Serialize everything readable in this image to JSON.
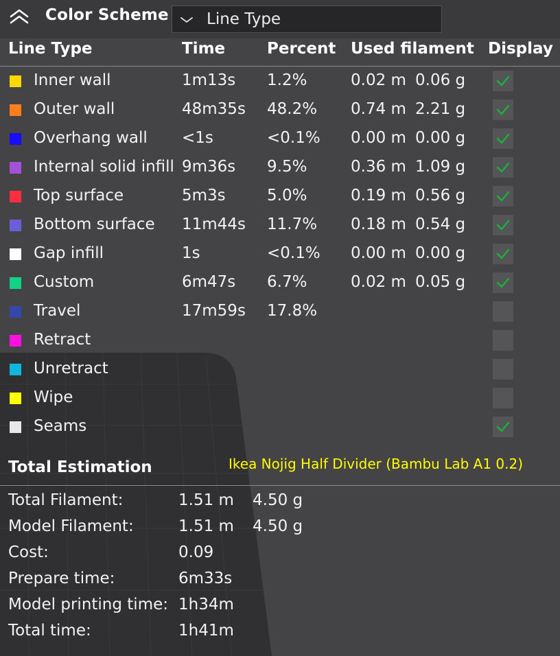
{
  "header": {
    "title": "Color Scheme",
    "dropdown_value": "Line Type"
  },
  "columns": {
    "line_type": "Line Type",
    "time": "Time",
    "percent": "Percent",
    "used_filament": "Used filament",
    "display": "Display"
  },
  "rows": [
    {
      "name": "Inner wall",
      "color": "#ffd700",
      "time": "1m13s",
      "percent": "1.2%",
      "length": "0.02 m",
      "weight": "0.06 g",
      "display": true
    },
    {
      "name": "Outer wall",
      "color": "#ff7f1e",
      "time": "48m35s",
      "percent": "48.2%",
      "length": "0.74 m",
      "weight": "2.21 g",
      "display": true
    },
    {
      "name": "Overhang wall",
      "color": "#1a0dff",
      "time": "<1s",
      "percent": "<0.1%",
      "length": "0.00 m",
      "weight": "0.00 g",
      "display": true
    },
    {
      "name": "Internal solid infill",
      "color": "#a352d8",
      "time": "9m36s",
      "percent": "9.5%",
      "length": "0.36 m",
      "weight": "1.09 g",
      "display": true
    },
    {
      "name": "Top surface",
      "color": "#ff2d40",
      "time": "5m3s",
      "percent": "5.0%",
      "length": "0.19 m",
      "weight": "0.56 g",
      "display": true
    },
    {
      "name": "Bottom surface",
      "color": "#6c5ed8",
      "time": "11m44s",
      "percent": "11.7%",
      "length": "0.18 m",
      "weight": "0.54 g",
      "display": true
    },
    {
      "name": "Gap infill",
      "color": "#ffffff",
      "time": "1s",
      "percent": "<0.1%",
      "length": "0.00 m",
      "weight": "0.00 g",
      "display": true
    },
    {
      "name": "Custom",
      "color": "#10d483",
      "time": "6m47s",
      "percent": "6.7%",
      "length": "0.02 m",
      "weight": "0.05 g",
      "display": true
    },
    {
      "name": "Travel",
      "color": "#3548aa",
      "time": "17m59s",
      "percent": "17.8%",
      "length": "",
      "weight": "",
      "display": false
    },
    {
      "name": "Retract",
      "color": "#ff10e0",
      "time": "",
      "percent": "",
      "length": "",
      "weight": "",
      "display": false
    },
    {
      "name": "Unretract",
      "color": "#0fb6e0",
      "time": "",
      "percent": "",
      "length": "",
      "weight": "",
      "display": false
    },
    {
      "name": "Wipe",
      "color": "#ffff00",
      "time": "",
      "percent": "",
      "length": "",
      "weight": "",
      "display": false
    },
    {
      "name": "Seams",
      "color": "#e8e8e8",
      "time": "",
      "percent": "",
      "length": "",
      "weight": "",
      "display": true
    }
  ],
  "model_label": "Ikea Nojig Half Divider (Bambu Lab A1 0.2)",
  "total": {
    "title": "Total Estimation",
    "rows": [
      {
        "label": "Total Filament:",
        "value": "1.51 m",
        "weight": "4.50 g"
      },
      {
        "label": "Model Filament:",
        "value": "1.51 m",
        "weight": "4.50 g"
      },
      {
        "label": "Cost:",
        "value": "0.09",
        "weight": ""
      },
      {
        "label": "Prepare time:",
        "value": "6m33s",
        "weight": ""
      },
      {
        "label": "Model printing time:",
        "value": "1h34m",
        "weight": ""
      },
      {
        "label": "Total time:",
        "value": "1h41m",
        "weight": ""
      }
    ]
  },
  "colors": {
    "check": "#19b23a",
    "panel_bg": "#444446",
    "plate": "#303032"
  },
  "icons": {
    "collapse": "chevron-double-up-icon",
    "dropdown": "chevron-down-icon",
    "checkbox": "check-icon"
  }
}
